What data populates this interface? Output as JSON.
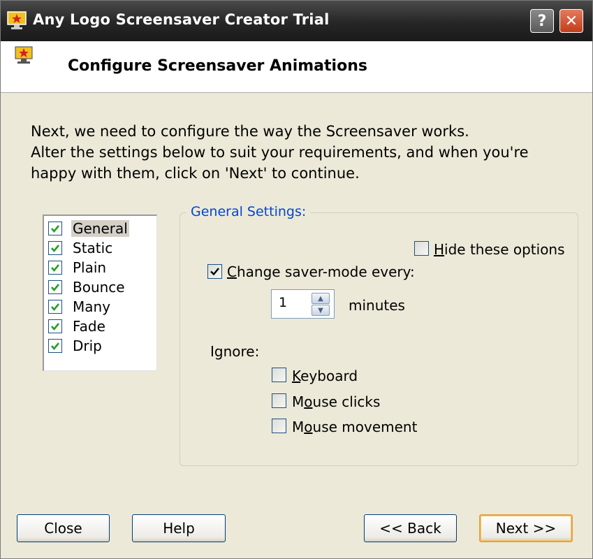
{
  "window": {
    "title": "Any Logo Screensaver Creator Trial",
    "help_label": "?",
    "close_label": "✕"
  },
  "header": {
    "title": "Configure Screensaver Animations"
  },
  "intro": {
    "line1": "Next, we need to configure the way the Screensaver works.",
    "line2": "Alter the settings below to suit your requirements, and when you're",
    "line3": "happy with them, click on 'Next' to continue."
  },
  "modes": {
    "items": [
      {
        "label": "General",
        "checked": true,
        "selected": true
      },
      {
        "label": "Static",
        "checked": true
      },
      {
        "label": "Plain",
        "checked": true
      },
      {
        "label": "Bounce",
        "checked": true
      },
      {
        "label": "Many",
        "checked": true
      },
      {
        "label": "Fade",
        "checked": true
      },
      {
        "label": "Drip",
        "checked": true
      }
    ]
  },
  "settings": {
    "legend": "General Settings:",
    "hide_options": {
      "label_u": "H",
      "label_rest": "ide these options",
      "checked": false
    },
    "change_mode": {
      "label_u": "C",
      "label_rest": "hange saver-mode every:",
      "checked": true
    },
    "interval_value": "1",
    "interval_unit": "minutes",
    "ignore_label": "Ignore:",
    "keyboard": {
      "label_u": "K",
      "label_rest": "eyboard",
      "checked": false
    },
    "mouse_clicks": {
      "label_pre": "M",
      "label_u": "o",
      "label_rest": "use clicks",
      "checked": false
    },
    "mouse_movement": {
      "label_pre": "M",
      "label_u": "o",
      "label_rest": "use movement",
      "checked": false
    }
  },
  "buttons": {
    "close": "Close",
    "help": "Help",
    "back": "<< Back",
    "next": "Next >>"
  },
  "colors": {
    "dialog_bg": "#ece9d8",
    "legend_blue": "#0046d5",
    "check_green": "#21a121",
    "default_button_border": "#e3a341"
  }
}
